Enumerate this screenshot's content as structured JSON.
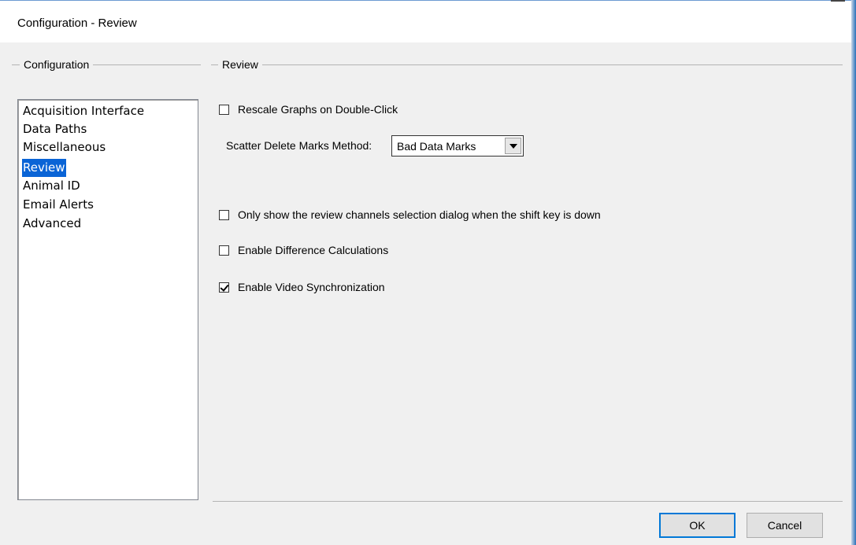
{
  "window": {
    "title": "Configuration - Review"
  },
  "configuration_group": {
    "legend": "Configuration",
    "items": [
      {
        "label": "Acquisition Interface",
        "selected": false
      },
      {
        "label": "Data Paths",
        "selected": false
      },
      {
        "label": "Miscellaneous",
        "selected": false
      },
      {
        "label": "Review",
        "selected": true
      },
      {
        "label": "Animal ID",
        "selected": false
      },
      {
        "label": "Email Alerts",
        "selected": false
      },
      {
        "label": "Advanced",
        "selected": false
      }
    ]
  },
  "review_group": {
    "legend": "Review",
    "rescale_graphs": {
      "label": "Rescale Graphs on Double-Click",
      "checked": false
    },
    "scatter_delete": {
      "label": "Scatter Delete Marks Method:",
      "value": "Bad Data Marks"
    },
    "only_show_dialog": {
      "label": "Only show the review channels selection dialog when the shift key is down",
      "checked": false
    },
    "difference_calc": {
      "label": "Enable Difference Calculations",
      "checked": false
    },
    "video_sync": {
      "label": "Enable Video Synchronization",
      "checked": true
    }
  },
  "buttons": {
    "ok": "OK",
    "cancel": "Cancel"
  },
  "colors": {
    "selection": "#0a64d6",
    "dialog_background": "#f0f0f0",
    "default_button_border": "#0078d7"
  }
}
